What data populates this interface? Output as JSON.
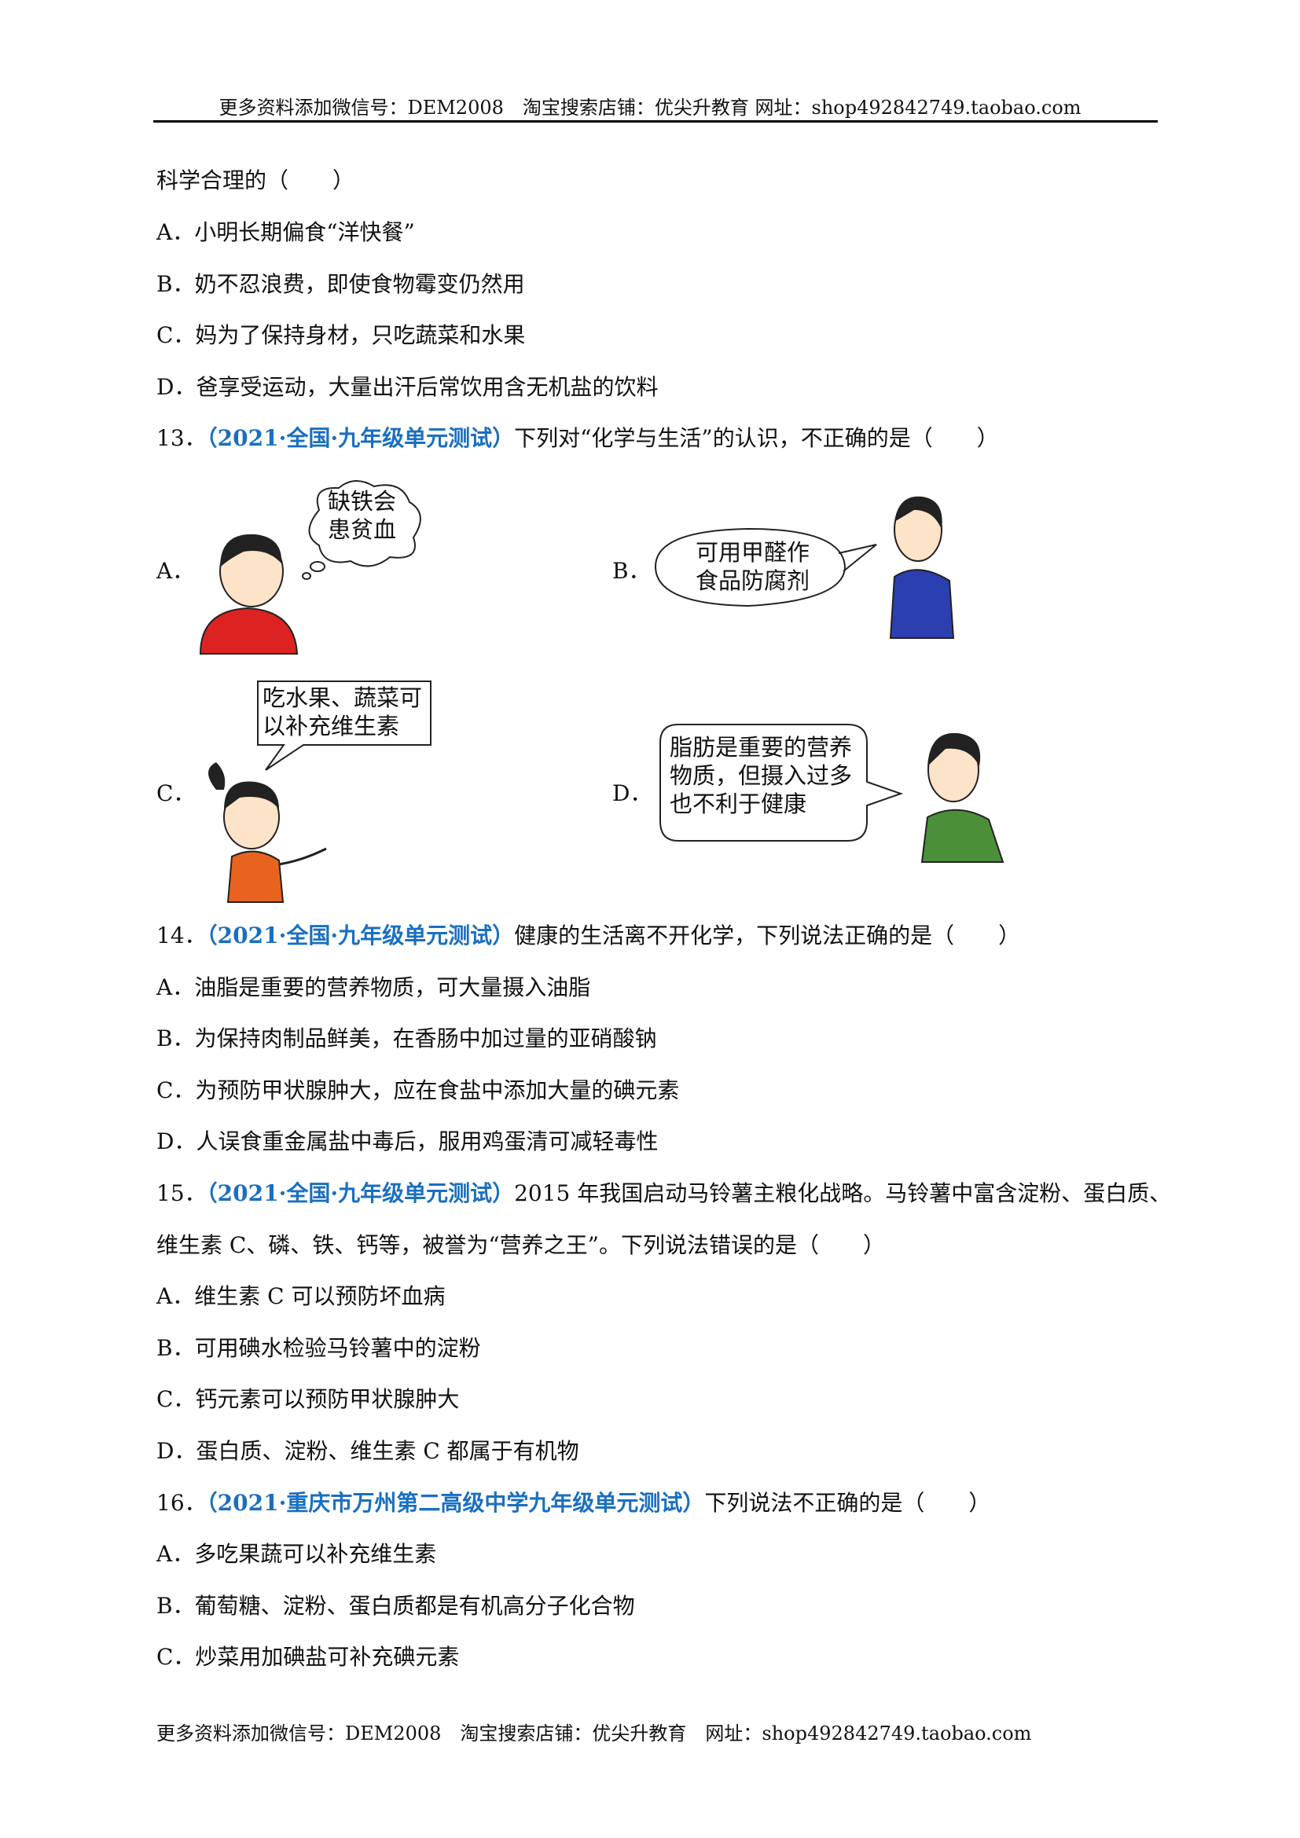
{
  "header": "更多资料添加微信号：DEM2008　淘宝搜索店铺：优尖升教育 网址：shop492842749.taobao.com",
  "q12": {
    "stem_tail": "科学合理的（　　）",
    "options": [
      "A．小明长期偏食“洋快餐”",
      "B．奶不忍浪费，即使食物霉变仍然用",
      "C．妈为了保持身材，只吃蔬菜和水果",
      "D．爸享受运动，大量出汗后常饮用含无机盐的饮料"
    ]
  },
  "q13": {
    "num": "13．",
    "source": "（2021·全国·九年级单元测试）",
    "stem": "下列对“化学与生活”的认识，不正确的是（　　）",
    "figures": [
      {
        "label": "A．",
        "bubble": [
          "缺铁会",
          "患贫血"
        ]
      },
      {
        "label": "B．",
        "bubble": [
          "可用甲醛作",
          "食品防腐剂"
        ]
      },
      {
        "label": "C．",
        "bubble": [
          "吃水果、蔬菜可",
          "以补充维生素"
        ]
      },
      {
        "label": "D．",
        "bubble": [
          "脂肪是重要的营养",
          "物质，但摄入过多",
          "也不利于健康"
        ]
      }
    ]
  },
  "q14": {
    "num": "14．",
    "source": "（2021·全国·九年级单元测试）",
    "stem": "健康的生活离不开化学，下列说法正确的是（　　）",
    "options": [
      "A．油脂是重要的营养物质，可大量摄入油脂",
      "B．为保持肉制品鲜美，在香肠中加过量的亚硝酸钠",
      "C．为预防甲状腺肿大，应在食盐中添加大量的碘元素",
      "D．人误食重金属盐中毒后，服用鸡蛋清可减轻毒性"
    ]
  },
  "q15": {
    "num": "15．",
    "source": "（2021·全国·九年级单元测试）",
    "stem1": "2015 年我国启动马铃薯主粮化战略。马铃薯中富含淀粉、蛋白质、",
    "stem2": "维生素 C、磷、铁、钙等，被誉为“营养之王”。下列说法错误的是（　　）",
    "options": [
      "A．维生素 C 可以预防坏血病",
      "B．可用碘水检验马铃薯中的淀粉",
      "C．钙元素可以预防甲状腺肿大",
      "D．蛋白质、淀粉、维生素 C 都属于有机物"
    ]
  },
  "q16": {
    "num": "16．",
    "source": "（2021·重庆市万州第二高级中学九年级单元测试）",
    "stem": "下列说法不正确的是（　　）",
    "options": [
      "A．多吃果蔬可以补充维生素",
      "B．葡萄糖、淀粉、蛋白质都是有机高分子化合物",
      "C．炒菜用加碘盐可补充碘元素"
    ]
  },
  "footer": "更多资料添加微信号：DEM2008　淘宝搜索店铺：优尖升教育　网址：shop492842749.taobao.com",
  "colors": {
    "source": "#1a6fc0"
  }
}
